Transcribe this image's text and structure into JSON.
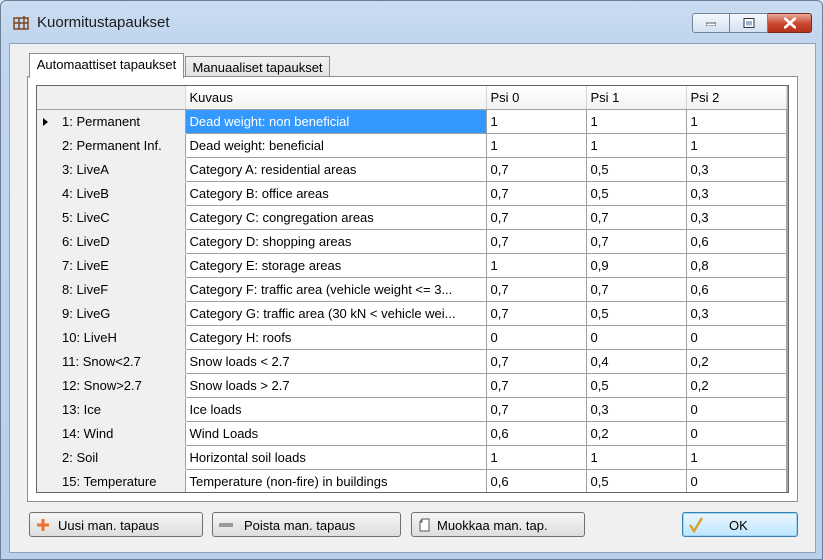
{
  "window": {
    "title": "Kuormitustapaukset"
  },
  "tabs": [
    {
      "label": "Automaattiset tapaukset",
      "active": true
    },
    {
      "label": "Manuaaliset tapaukset",
      "active": false
    }
  ],
  "grid": {
    "columns": [
      "Kuvaus",
      "Psi 0",
      "Psi 1",
      "Psi 2"
    ],
    "rows": [
      {
        "name": "1: Permanent",
        "desc": "Dead weight: non beneficial",
        "psi0": "1",
        "psi1": "1",
        "psi2": "1",
        "current": true
      },
      {
        "name": "2: Permanent Inf.",
        "desc": "Dead weight: beneficial",
        "psi0": "1",
        "psi1": "1",
        "psi2": "1"
      },
      {
        "name": "3: LiveA",
        "desc": "Category A: residential areas",
        "psi0": "0,7",
        "psi1": "0,5",
        "psi2": "0,3"
      },
      {
        "name": "4: LiveB",
        "desc": "Category B: office areas",
        "psi0": "0,7",
        "psi1": "0,5",
        "psi2": "0,3"
      },
      {
        "name": "5: LiveC",
        "desc": "Category C: congregation areas",
        "psi0": "0,7",
        "psi1": "0,7",
        "psi2": "0,3"
      },
      {
        "name": "6: LiveD",
        "desc": "Category D: shopping areas",
        "psi0": "0,7",
        "psi1": "0,7",
        "psi2": "0,6"
      },
      {
        "name": "7: LiveE",
        "desc": "Category E: storage areas",
        "psi0": "1",
        "psi1": "0,9",
        "psi2": "0,8"
      },
      {
        "name": "8: LiveF",
        "desc": "Category F: traffic area (vehicle weight <= 3...",
        "psi0": "0,7",
        "psi1": "0,7",
        "psi2": "0,6"
      },
      {
        "name": "9: LiveG",
        "desc": "Category G: traffic area (30 kN < vehicle wei...",
        "psi0": "0,7",
        "psi1": "0,5",
        "psi2": "0,3"
      },
      {
        "name": "10: LiveH",
        "desc": "Category H: roofs",
        "psi0": "0",
        "psi1": "0",
        "psi2": "0"
      },
      {
        "name": "11: Snow<2.7",
        "desc": "Snow loads < 2.7",
        "psi0": "0,7",
        "psi1": "0,4",
        "psi2": "0,2"
      },
      {
        "name": "12: Snow>2.7",
        "desc": "Snow loads > 2.7",
        "psi0": "0,7",
        "psi1": "0,5",
        "psi2": "0,2"
      },
      {
        "name": "13: Ice",
        "desc": "Ice loads",
        "psi0": "0,7",
        "psi1": "0,3",
        "psi2": "0"
      },
      {
        "name": "14: Wind",
        "desc": "Wind Loads",
        "psi0": "0,6",
        "psi1": "0,2",
        "psi2": "0"
      },
      {
        "name": "2: Soil",
        "desc": "Horizontal soil loads",
        "psi0": "1",
        "psi1": "1",
        "psi2": "1"
      },
      {
        "name": "15: Temperature",
        "desc": "Temperature (non-fire) in buildings",
        "psi0": "0,6",
        "psi1": "0,5",
        "psi2": "0"
      }
    ]
  },
  "buttons": {
    "add": "Uusi man. tapaus",
    "remove": "Poista man. tapaus",
    "edit": "Muokkaa man. tap.",
    "ok": "OK"
  },
  "icons": {
    "app": "structure-grid-icon",
    "add": "plus-icon",
    "remove": "minus-icon",
    "edit": "edit-document-icon",
    "ok": "checkmark-icon"
  },
  "colors": {
    "selection": "#3399ff",
    "add_icon": "#e8742f",
    "ok_check": "#d9a224"
  }
}
